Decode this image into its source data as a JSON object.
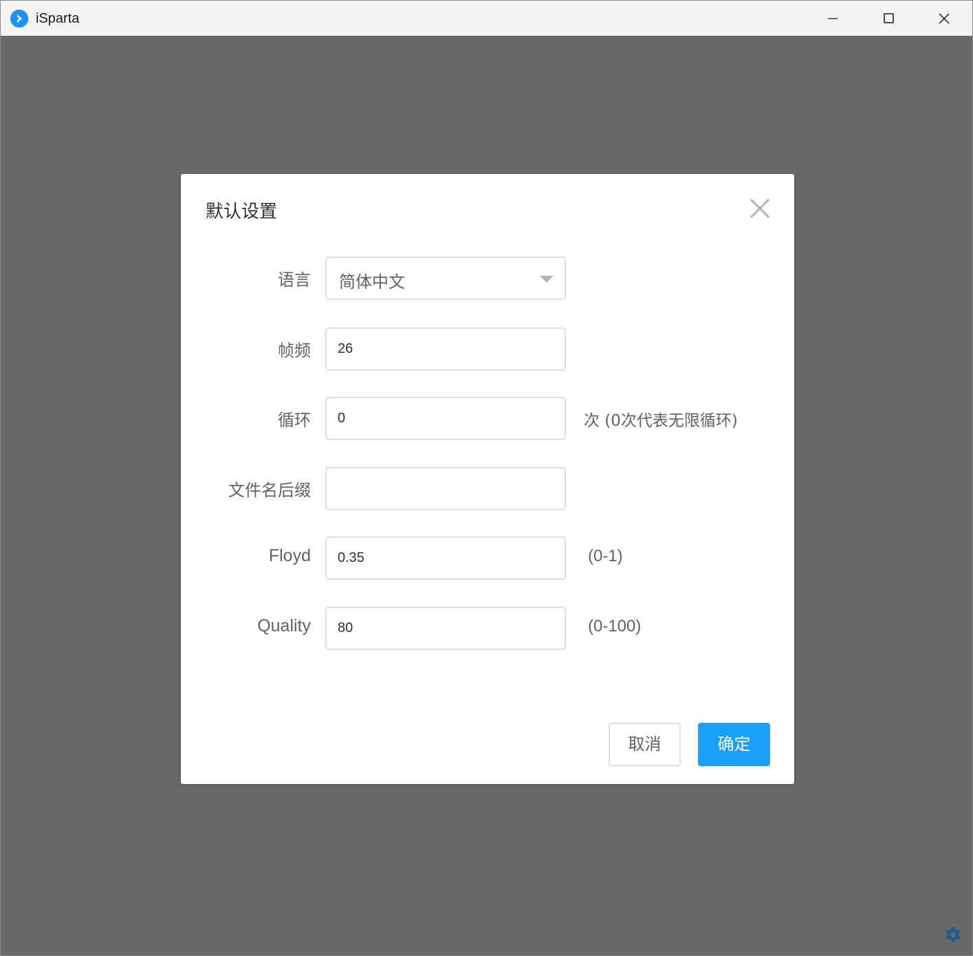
{
  "window": {
    "title": "iSparta",
    "controls": [
      "minimize-icon",
      "maximize-icon",
      "close-icon"
    ]
  },
  "dialog": {
    "title": "默认设置",
    "fields": {
      "language": {
        "label": "语言",
        "value": "简体中文"
      },
      "framerate": {
        "label": "帧频",
        "value": "26"
      },
      "loop": {
        "label": "循环",
        "value": "0",
        "hint": "次 (0次代表无限循环)"
      },
      "suffix": {
        "label": "文件名后缀",
        "value": ""
      },
      "floyd": {
        "label": "Floyd",
        "value": "0.35",
        "hint": "(0-1)"
      },
      "quality": {
        "label": "Quality",
        "value": "80",
        "hint": "(0-100)"
      }
    },
    "buttons": {
      "cancel": "取消",
      "ok": "确定"
    }
  },
  "colors": {
    "primary": "#1a9efb",
    "overlay": "#696969",
    "label": "#606266",
    "border": "#dcdfe6",
    "gear": "#1f5d8c"
  }
}
